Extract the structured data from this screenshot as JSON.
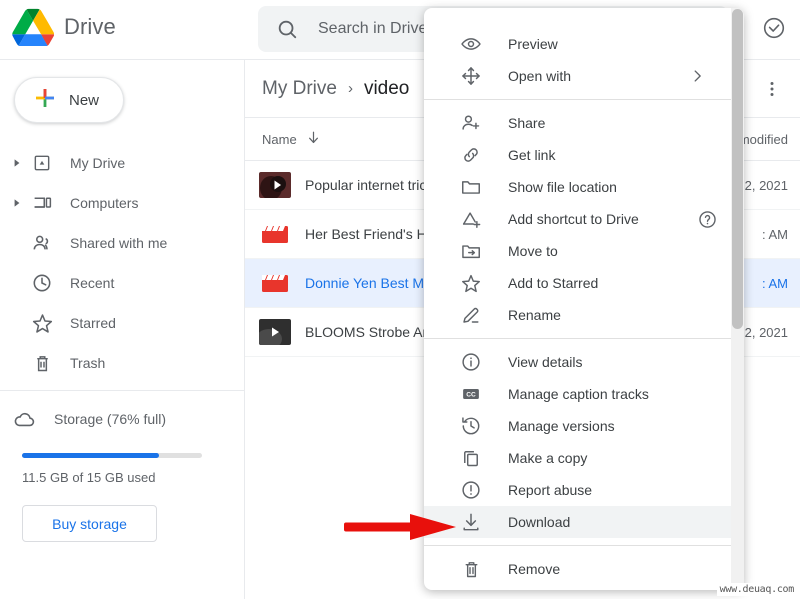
{
  "app": {
    "brand": "Drive",
    "logo_icon": "drive-logo-icon"
  },
  "search": {
    "placeholder": "Search in Drive",
    "value": "",
    "icon": "search-icon"
  },
  "topbar": {
    "support_icon": "check-circle-icon"
  },
  "sidebar": {
    "new_button": {
      "label": "New",
      "icon": "plus-icon"
    },
    "items": [
      {
        "label": "My Drive",
        "icon": "my-drive-icon",
        "expandable": true
      },
      {
        "label": "Computers",
        "icon": "computers-icon",
        "expandable": true
      },
      {
        "label": "Shared with me",
        "icon": "shared-with-me-icon",
        "expandable": false
      },
      {
        "label": "Recent",
        "icon": "clock-icon",
        "expandable": false
      },
      {
        "label": "Starred",
        "icon": "star-icon",
        "expandable": false
      },
      {
        "label": "Trash",
        "icon": "trash-icon",
        "expandable": false
      }
    ],
    "storage": {
      "icon": "cloud-icon",
      "label": "Storage (76% full)",
      "percent_full": 76,
      "used_text": "11.5 GB of 15 GB used",
      "buy_button": "Buy storage",
      "bar_color": "#1a73e8"
    }
  },
  "main": {
    "breadcrumb": {
      "root": "My Drive",
      "separator": "›",
      "current": "video"
    },
    "toolbar": {
      "trash_icon": "trash-icon",
      "more_icon": "more-vert-icon"
    },
    "columns": {
      "name": "Name",
      "sort_icon": "arrow-down-icon",
      "modified": "t modified"
    },
    "rows": [
      {
        "name": "Popular internet tric",
        "modified": "2, 2021",
        "thumb": "video-thumb-dark",
        "selected": false
      },
      {
        "name": "Her Best Friend's H",
        "modified": ": AM",
        "thumb": "clapperboard-icon",
        "selected": false
      },
      {
        "name": "Donnie Yen Best Mo",
        "modified": ": AM",
        "thumb": "clapperboard-icon",
        "selected": true
      },
      {
        "name": "BLOOMS Strobe An",
        "modified": "2, 2021",
        "thumb": "video-thumb-gray",
        "selected": false
      }
    ]
  },
  "context_menu": {
    "groups": [
      [
        {
          "label": "Preview",
          "icon": "eye-icon"
        },
        {
          "label": "Open with",
          "icon": "open-with-icon",
          "submenu_icon": "chevron-right-icon"
        }
      ],
      [
        {
          "label": "Share",
          "icon": "person-add-icon"
        },
        {
          "label": "Get link",
          "icon": "link-icon"
        },
        {
          "label": "Show file location",
          "icon": "folder-icon"
        },
        {
          "label": "Add shortcut to Drive",
          "icon": "add-shortcut-icon",
          "help_icon": "help-circle-icon"
        },
        {
          "label": "Move to",
          "icon": "move-to-folder-icon"
        },
        {
          "label": "Add to Starred",
          "icon": "star-icon"
        },
        {
          "label": "Rename",
          "icon": "pencil-icon"
        }
      ],
      [
        {
          "label": "View details",
          "icon": "info-icon"
        },
        {
          "label": "Manage caption tracks",
          "icon": "closed-caption-icon"
        },
        {
          "label": "Manage versions",
          "icon": "history-icon"
        },
        {
          "label": "Make a copy",
          "icon": "copy-icon"
        },
        {
          "label": "Report abuse",
          "icon": "report-icon"
        },
        {
          "label": "Download",
          "icon": "download-icon",
          "highlighted": true
        }
      ],
      [
        {
          "label": "Remove",
          "icon": "trash-icon"
        }
      ]
    ]
  },
  "annotation": {
    "arrow_color": "#e8100c",
    "points_to": "Download"
  },
  "watermark": {
    "text": "www.deuaq.com"
  }
}
